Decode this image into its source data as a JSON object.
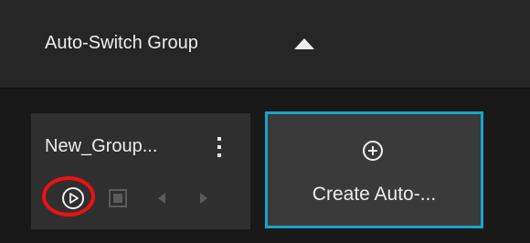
{
  "header": {
    "title": "Auto-Switch Group",
    "collapse_icon": "triangle-up-icon"
  },
  "groups": [
    {
      "name": "New_Group...",
      "menu_icon": "kebab-menu-icon",
      "controls": {
        "play_icon": "play-circle-icon",
        "stop_icon": "stop-square-icon",
        "prev_icon": "chevron-left-icon",
        "next_icon": "chevron-right-icon"
      }
    }
  ],
  "create_card": {
    "label": "Create Auto-...",
    "icon": "plus-circle-icon"
  },
  "colors": {
    "background": "#191919",
    "header_background": "#262626",
    "card_background": "#2f2f2f",
    "create_background": "#3a3a3a",
    "accent": "#1ba3cc",
    "highlight": "#ee1111"
  }
}
